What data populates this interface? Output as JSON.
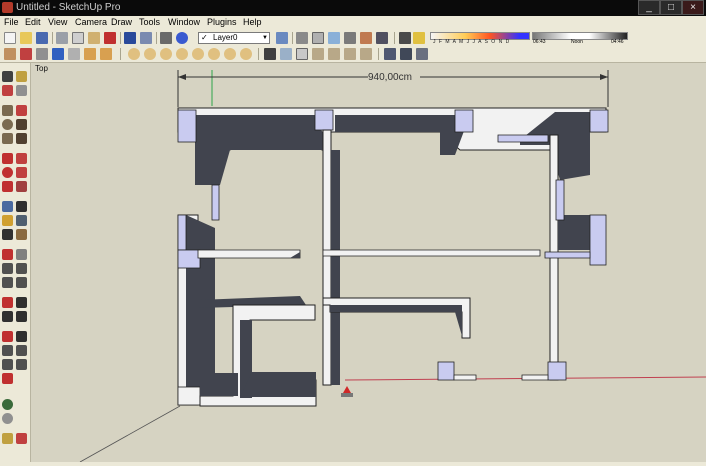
{
  "window": {
    "title": "Untitled - SketchUp Pro",
    "minimize": "_",
    "maximize": "□",
    "close": "×"
  },
  "menu": [
    "File",
    "Edit",
    "View",
    "Camera",
    "Draw",
    "Tools",
    "Window",
    "Plugins",
    "Help"
  ],
  "layer": {
    "name": "Layer0",
    "checkmark": "✓",
    "dropdown": "▼"
  },
  "shadow": {
    "months": "J F M A M J J A S O N D",
    "time_start": "06:43",
    "time_noon": "Noon",
    "time_end": "04:46"
  },
  "viewport": {
    "view_label": "Top",
    "dimension_text": "940,00cm"
  }
}
